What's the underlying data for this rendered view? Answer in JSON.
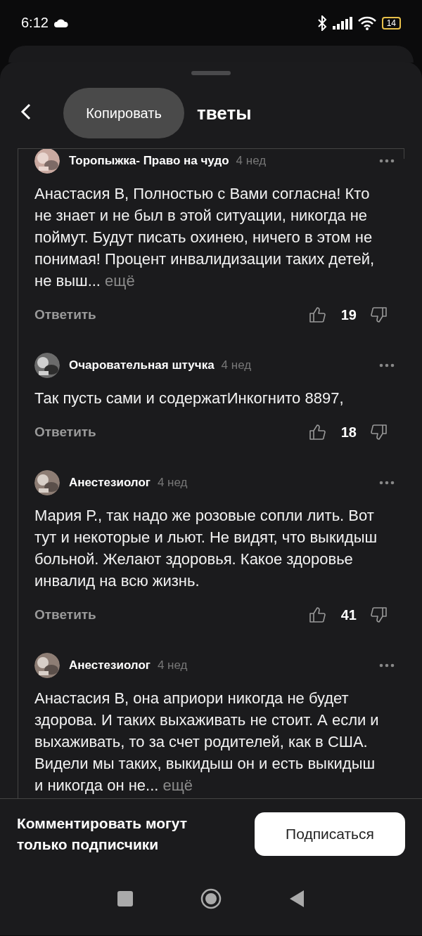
{
  "status_bar": {
    "time": "6:12",
    "battery": "14"
  },
  "header": {
    "title": "тветы",
    "tooltip": "Копировать"
  },
  "comments": [
    {
      "author": "Торопыжка- Право на чудо",
      "time": "4 нед",
      "text": "Анастасия В, Полностью с Вами согласна! Кто не знает и не был в этой ситуации, никогда не поймут. Будут писать охинею, ничего в этом не понимая! Процент инвалидизации таких детей, не выш...",
      "more": "ещё",
      "reply": "Ответить",
      "likes": "19"
    },
    {
      "author": "Очаровательная  штучка",
      "time": "4 нед",
      "text": "Так пусть сами и содержатИнкогнито 8897,",
      "reply": "Ответить",
      "likes": "18"
    },
    {
      "author": "Анестезиолог",
      "time": "4 нед",
      "text": "Мария Р., так надо же розовые сопли лить. Вот тут и некоторые и льют. Не видят, что выкидыш больной. Желают здоровья. Какое здоровье инвалид на всю жизнь.",
      "reply": "Ответить",
      "likes": "41"
    },
    {
      "author": "Анестезиолог",
      "time": "4 нед",
      "text": "Анастасия В, она априори никогда не будет здорова. И таких выхаживать не стоит. А если и выхаживать, то за счет родителей, как в США. Видели мы таких, выкидыш он и есть выкидыш и никогда он не...",
      "more": "ещё"
    }
  ],
  "footer": {
    "notice": "Комментировать могут только подписчики",
    "button": "Подписаться"
  }
}
